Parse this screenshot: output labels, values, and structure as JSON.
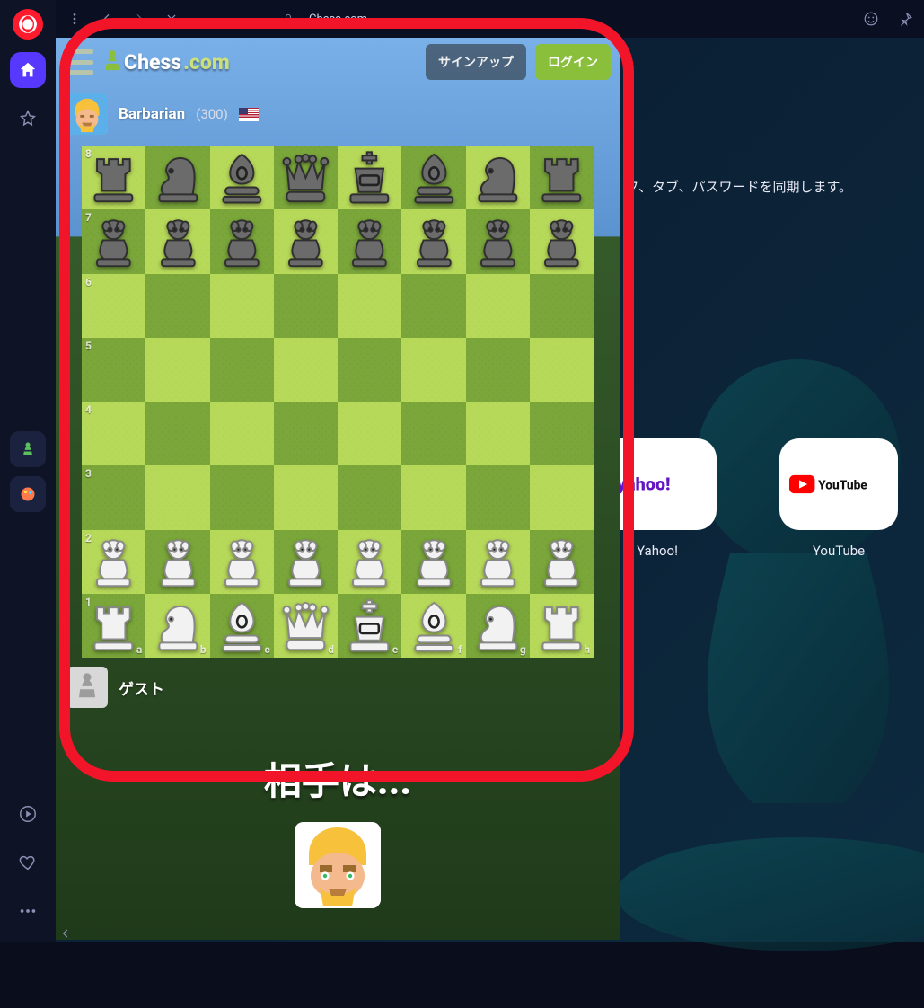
{
  "browser": {
    "tab_title": "Chess.com"
  },
  "desktop": {
    "sync_text": "フ、タブ、パスワードを同期します。",
    "shortcuts": [
      {
        "label": "Yahoo!"
      },
      {
        "label": "YouTube"
      }
    ]
  },
  "chess": {
    "logo_main": "Chess",
    "logo_suffix": ".com",
    "signup_label": "サインアップ",
    "login_label": "ログイン",
    "opponent": {
      "name": "Barbarian",
      "rating": "(300)",
      "country": "US"
    },
    "self": {
      "name": "ゲスト"
    },
    "banner": "相手は...",
    "board": {
      "ranks": [
        "8",
        "7",
        "6",
        "5",
        "4",
        "3",
        "2",
        "1"
      ],
      "files": [
        "a",
        "b",
        "c",
        "d",
        "e",
        "f",
        "g",
        "h"
      ],
      "position_fen": "rnbqkbnr/pppppppp/8/8/8/8/PPPPPPPP/RNBQKBNR"
    }
  }
}
